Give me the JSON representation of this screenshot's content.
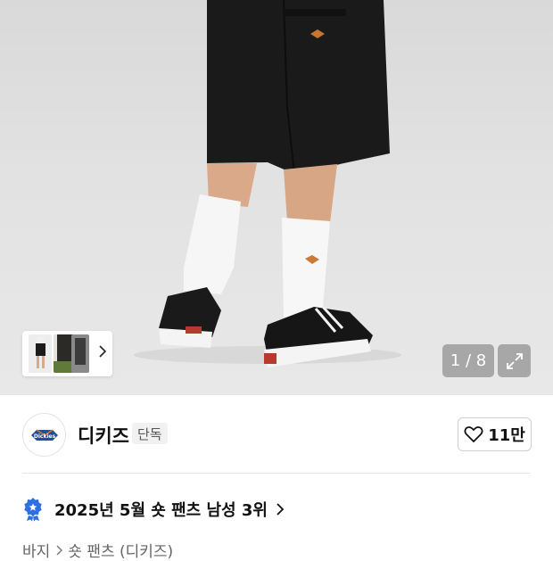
{
  "gallery": {
    "counter": "1 / 8",
    "thumb_colors": [
      "#1b1b1b",
      "#2b2a26",
      "#3c3c3c"
    ]
  },
  "brand": {
    "name": "디키즈",
    "tag": "단독",
    "logo_text": "Dickies",
    "likes": "11만"
  },
  "ranking": {
    "text": "2025년 5월 숏 팬츠 남성 3위"
  },
  "breadcrumb": {
    "items": [
      "바지",
      "숏 팬츠 (디키즈)"
    ]
  },
  "colors": {
    "badge_blue": "#2f6fe4",
    "text_primary": "#111111"
  }
}
